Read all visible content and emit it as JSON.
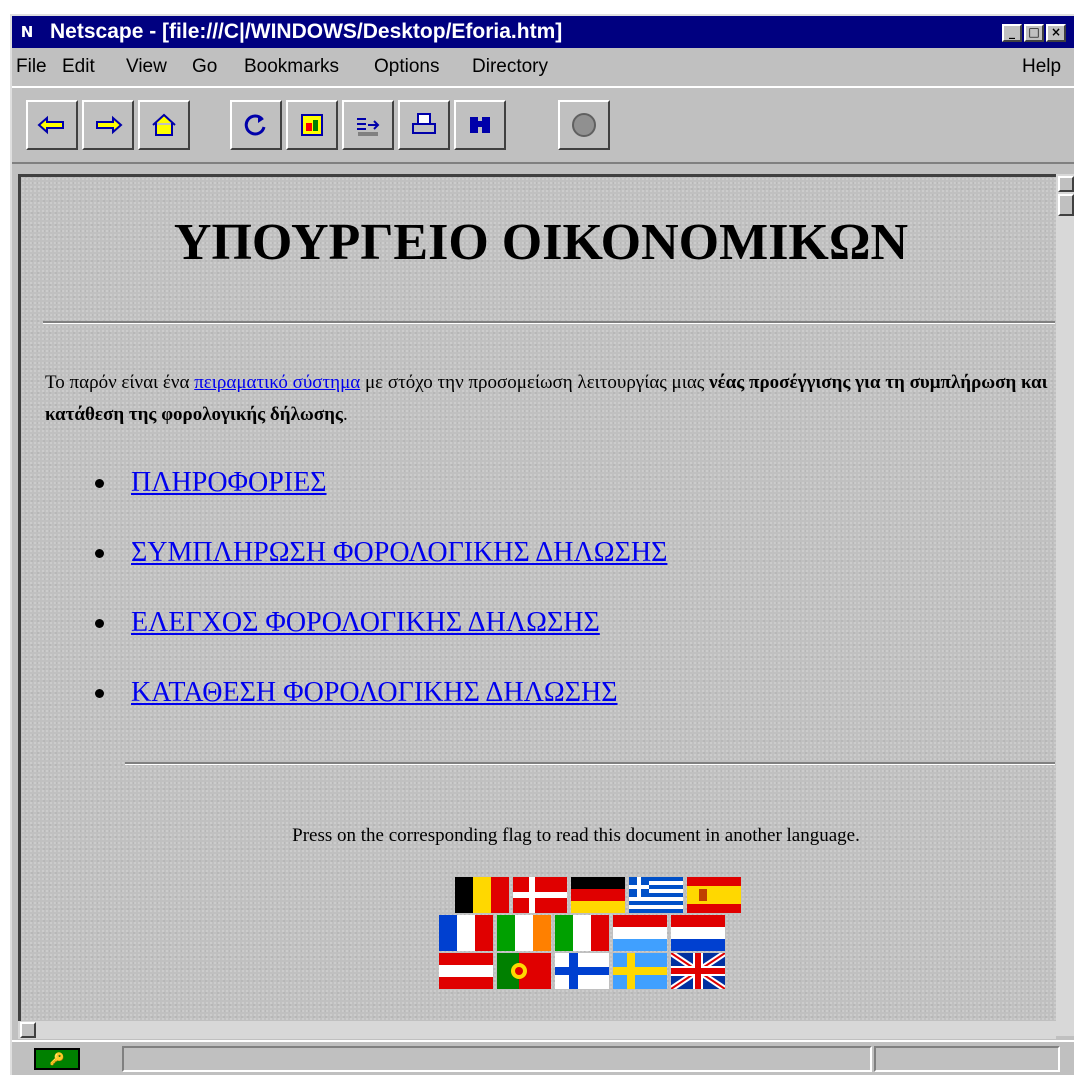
{
  "window": {
    "title": "Netscape - [file:///C|/WINDOWS/Desktop/Eforia.htm]"
  },
  "menu": {
    "items": [
      {
        "label": "File"
      },
      {
        "label": "Edit"
      },
      {
        "label": "View"
      },
      {
        "label": "Go"
      },
      {
        "label": "Bookmarks"
      },
      {
        "label": "Options"
      },
      {
        "label": "Directory"
      }
    ],
    "help": "Help"
  },
  "toolbar": {
    "buttons": [
      {
        "icon": "back-arrow-icon"
      },
      {
        "icon": "forward-arrow-icon"
      },
      {
        "icon": "home-icon"
      },
      {
        "icon": "reload-icon"
      },
      {
        "icon": "images-icon"
      },
      {
        "icon": "open-icon"
      },
      {
        "icon": "print-icon"
      },
      {
        "icon": "find-icon"
      },
      {
        "icon": "stop-icon"
      }
    ]
  },
  "page": {
    "heading": "ΥΠΟΥΡΓΕΙΟ ΟΙΚΟΝΟΜΙΚΩΝ",
    "intro_before": "Το παρόν είναι ένα ",
    "intro_link": "πειραματικό σύστημα",
    "intro_after": " με στόχο την προσομείωση λειτουργίας μιας ",
    "intro_bold": "νέας προσέγγισης για τη συμπλήρωση και κατάθεση της φορολογικής δήλωσης",
    "intro_end": ".",
    "links": [
      {
        "label": "ΠΛΗΡΟΦΟΡΙΕΣ"
      },
      {
        "label": "ΣΥΜΠΛΗΡΩΣΗ ΦΟΡΟΛΟΓΙΚΗΣ ΔΗΛΩΣΗΣ"
      },
      {
        "label": "ΕΛΕΓΧΟΣ ΦΟΡΟΛΟΓΙΚΗΣ ΔΗΛΩΣΗΣ"
      },
      {
        "label": "ΚΑΤΑΘΕΣΗ ΦΟΡΟΛΟΓΙΚΗΣ ΔΗΛΩΣΗΣ"
      }
    ],
    "language_note": "Press on the corresponding flag to read this document in another language.",
    "flags": [
      "belgium-flag-icon",
      "denmark-flag-icon",
      "germany-flag-icon",
      "greece-flag-icon",
      "spain-flag-icon",
      "france-flag-icon",
      "ireland-flag-icon",
      "italy-flag-icon",
      "luxembourg-flag-icon",
      "netherlands-flag-icon",
      "austria-flag-icon",
      "portugal-flag-icon",
      "finland-flag-icon",
      "sweden-flag-icon",
      "uk-flag-icon"
    ]
  },
  "colors": {
    "titlebar": "#000080",
    "link": "#0000ee",
    "window": "#c0c0c0"
  }
}
